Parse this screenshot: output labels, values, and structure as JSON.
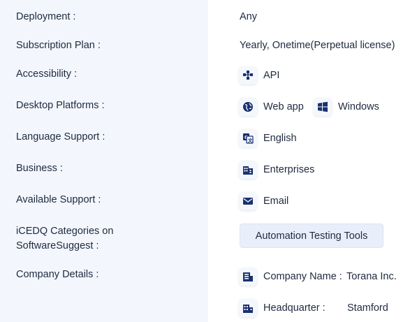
{
  "labels": {
    "deployment": "Deployment :",
    "subscription": "Subscription Plan :",
    "accessibility": "Accessibility :",
    "desktop": "Desktop Platforms :",
    "language": "Language Support :",
    "business": "Business :",
    "support": "Available Support :",
    "categories_line1": "iCEDQ Categories on",
    "categories_line2": "SoftwareSuggest :",
    "company": "Company Details :"
  },
  "values": {
    "deployment": "Any",
    "subscription": "Yearly, Onetime(Perpetual license)",
    "accessibility": [
      {
        "label": "API",
        "icon": "api-icon"
      }
    ],
    "desktop": [
      {
        "label": "Web app",
        "icon": "globe-icon"
      },
      {
        "label": "Windows",
        "icon": "windows-icon"
      }
    ],
    "language": [
      {
        "label": "English",
        "icon": "translate-icon"
      }
    ],
    "business": [
      {
        "label": "Enterprises",
        "icon": "building-icon"
      }
    ],
    "support": [
      {
        "label": "Email",
        "icon": "email-icon"
      }
    ],
    "categories": [
      {
        "label": "Automation Testing Tools"
      }
    ],
    "company": {
      "name_label": "Company Name :",
      "name_value": "Torana Inc.",
      "hq_label": "Headquarter :",
      "hq_value": "Stamford"
    }
  },
  "colors": {
    "left_panel_bg": "#f3f7fd",
    "text": "#1e2a3f",
    "icon": "#1a3170",
    "tag_bg": "#e9effa"
  }
}
